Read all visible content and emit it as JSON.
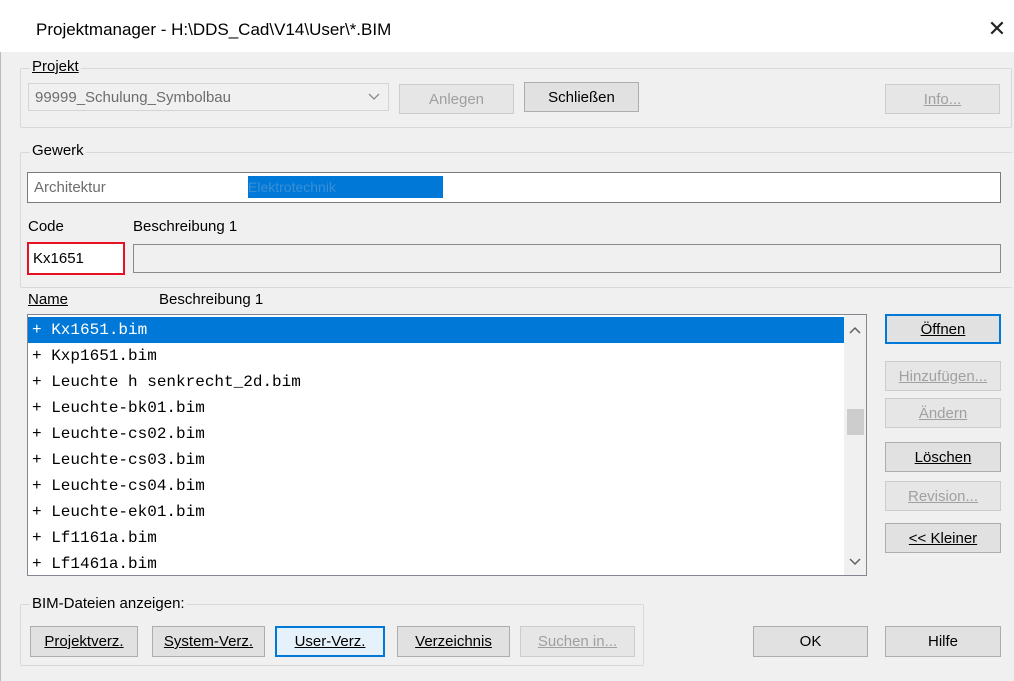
{
  "window": {
    "title": "Projektmanager - H:\\DDS_Cad\\V14\\User\\*.BIM",
    "close_glyph": "✕"
  },
  "projekt": {
    "label": "Projekt",
    "selected": "99999_Schulung_Symbolbau",
    "btn_anlegen": "Anlegen",
    "btn_schliessen": "Schließen",
    "btn_info": "Info..."
  },
  "gewerk": {
    "label": "Gewerk",
    "items": [
      "Architektur",
      "Elektrotechnik"
    ]
  },
  "code": {
    "label": "Code",
    "beschreibung_label": "Beschreibung 1",
    "value": "Kx1651",
    "beschreibung_value": ""
  },
  "list": {
    "col_name": "Name",
    "col_beschreibung": "Beschreibung 1",
    "items": [
      "+ Kx1651.bim",
      "+ Kxp1651.bim",
      "+ Leuchte h senkrecht_2d.bim",
      "+ Leuchte-bk01.bim",
      "+ Leuchte-cs02.bim",
      "+ Leuchte-cs03.bim",
      "+ Leuchte-cs04.bim",
      "+ Leuchte-ek01.bim",
      "+ Lf1161a.bim",
      "+ Lf1461a.bim"
    ],
    "selected_index": 0
  },
  "side_buttons": {
    "oeffnen": "Öffnen",
    "hinzufuegen": "Hinzufügen...",
    "aendern": "Ändern",
    "loeschen": "Löschen",
    "revision": "Revision...",
    "kleiner": "<< Kleiner"
  },
  "bim": {
    "label": "BIM-Dateien anzeigen:",
    "projektverz": "Projektverz.",
    "systemverz": "System-Verz.",
    "userverz": "User-Verz.",
    "verzeichnis": "Verzeichnis",
    "suchen": "Suchen in..."
  },
  "footer": {
    "ok": "OK",
    "hilfe": "Hilfe"
  },
  "colors": {
    "accent": "#0078d7",
    "code_border": "#e81123"
  }
}
